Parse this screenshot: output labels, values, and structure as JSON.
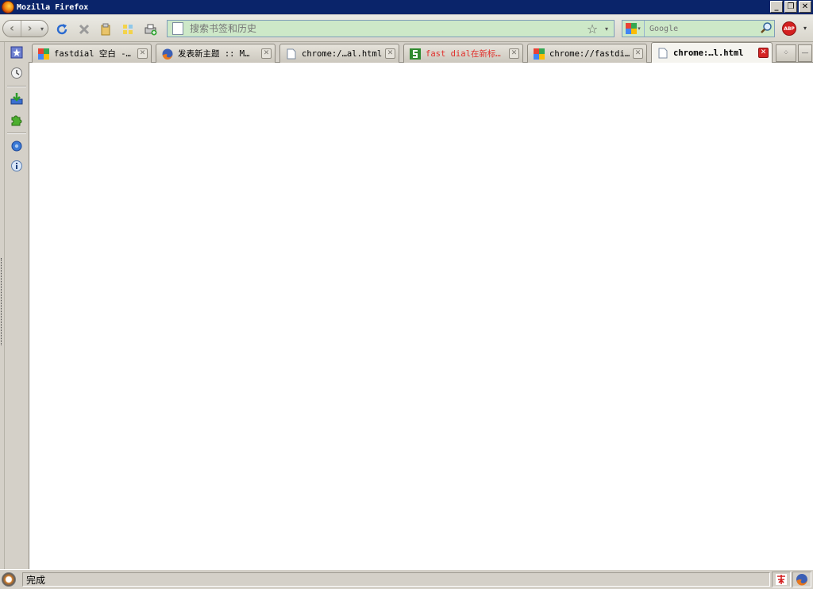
{
  "window": {
    "title": "Mozilla Firefox",
    "minimize_glyph": "_",
    "restore_glyph": "❐",
    "close_glyph": "✕"
  },
  "toolbar": {
    "back_glyph": "‹",
    "forward_glyph": "›",
    "history_drop_glyph": "▾",
    "url_placeholder": "搜索书签和历史",
    "bookmark_star_glyph": "☆",
    "url_drop_glyph": "▾",
    "search_placeholder": "Google",
    "search_engine_drop_glyph": "▾",
    "abp_label": "ABP",
    "abp_drop_glyph": "▾"
  },
  "tabs": [
    {
      "label": "fastdial 空白 -…",
      "favicon": "google-icon",
      "active": false,
      "color": "#000000"
    },
    {
      "label": "发表新主题 :: M…",
      "favicon": "firefox-icon",
      "active": false,
      "color": "#000000"
    },
    {
      "label": "chrome:/…al.html",
      "favicon": "page-icon",
      "active": false,
      "color": "#000000"
    },
    {
      "label": "fast dial在新标…",
      "favicon": "green-s-icon",
      "active": false,
      "color": "#e0302c"
    },
    {
      "label": "chrome://fastdi…",
      "favicon": "google-icon",
      "active": false,
      "color": "#000000"
    },
    {
      "label": "chrome:…l.html",
      "favicon": "page-icon",
      "active": true,
      "color": "#000000"
    }
  ],
  "tab_close_glyph": "✕",
  "tab_scroll_glyph": "⁘",
  "tab_list_glyph": "—",
  "status": {
    "text": "完成"
  },
  "colors": {
    "titlebar": "#0a246a",
    "urlbar_bg": "#cde8c8",
    "active_close": "#d52424"
  }
}
